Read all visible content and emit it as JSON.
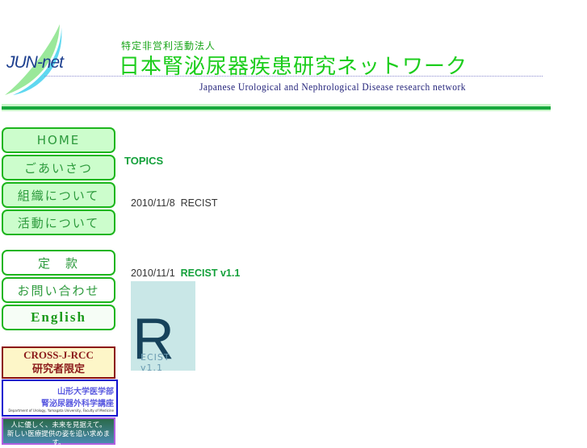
{
  "header": {
    "logo_text": "JUN-net",
    "org_type": "特定非営利活動法人",
    "title": "日本腎泌尿器疾患研究ネットワーク",
    "subtitle": "Japanese Urological and Nephrological Disease research network"
  },
  "nav": {
    "items": [
      {
        "label": "HOME"
      },
      {
        "label": "ごあいさつ"
      },
      {
        "label": "組織について"
      },
      {
        "label": "活動について"
      },
      {
        "label": "定　款"
      },
      {
        "label": "お問い合わせ"
      },
      {
        "label": "English"
      }
    ]
  },
  "banners": {
    "cross": {
      "line1": "CROSS-J-RCC",
      "line2": "研究者限定"
    },
    "yamagata": {
      "line1": "山形大学医学部",
      "line2": "腎泌尿器外科学講座",
      "line3": "Department of Urology, Yamagata University, Faculty of Medicine"
    },
    "third": {
      "line1": "人に優しく、未来を見据えて。",
      "line2": "新しい医療提供の姿を追い求めます。"
    }
  },
  "main": {
    "heading": "TOPICS",
    "news": [
      {
        "date": "2010/11/8",
        "title": "RECIST"
      },
      {
        "date": "2010/11/1",
        "title": "RECIST v1.1",
        "thumb_big": "R",
        "thumb_text": "ECIST v1.1"
      }
    ]
  }
}
